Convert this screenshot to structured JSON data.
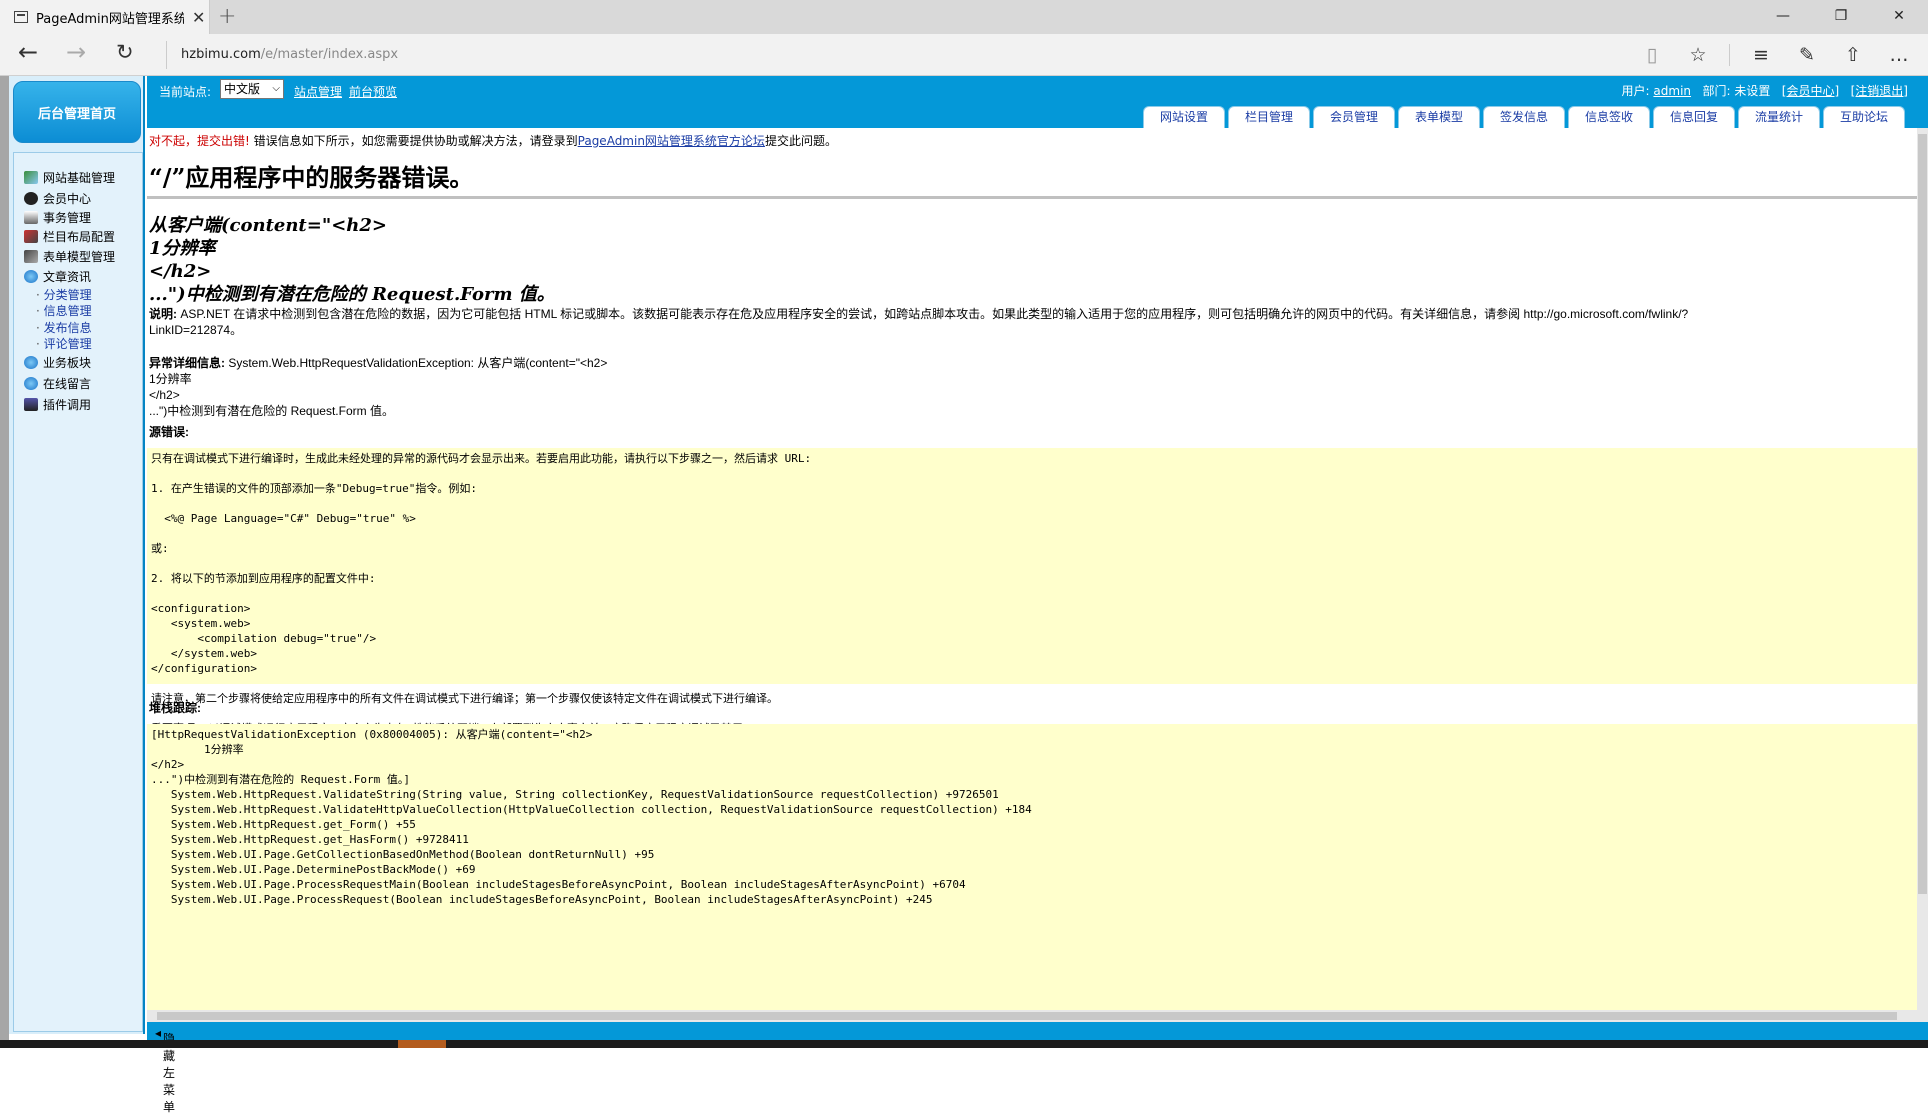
{
  "browser": {
    "tab_title": "PageAdmin网站管理系统",
    "url_host": "hzbimu.com",
    "url_path": "/e/master/index.aspx"
  },
  "topbar": {
    "site_label": "当前站点:",
    "site_value": "中文版",
    "link_site_manage": "站点管理",
    "link_preview": "前台预览",
    "user_label": "用户:",
    "user_name": "admin",
    "dept": "部门: 未设置",
    "member_center": "[会员中心]",
    "logout": "[注销退出]"
  },
  "nav_tabs": [
    "网站设置",
    "栏目管理",
    "会员管理",
    "表单模型",
    "签发信息",
    "信息签收",
    "信息回复",
    "流量统计",
    "互助论坛"
  ],
  "sidebar": {
    "home_label": "后台管理首页",
    "items": [
      "网站基础管理",
      "会员中心",
      "事务管理",
      "栏目布局配置",
      "表单模型管理",
      "文章资讯"
    ],
    "subitems": [
      "分类管理",
      "信息管理",
      "发布信息",
      "评论管理"
    ],
    "items2": [
      "业务板块",
      "在线留言",
      "插件调用"
    ],
    "hide_menu": "隐藏左菜单"
  },
  "content": {
    "err_prefix": "对不起，提交出错!",
    "err_text": " 错误信息如下所示，如您需要提供协助或解决方法，请登录到",
    "err_link": "PageAdmin网站管理系统官方论坛",
    "err_suffix": "提交此问题。",
    "title": "“/”应用程序中的服务器错误。",
    "h2_lines": [
      "从客户端(content=\"<h2>",
      "1分辨率",
      "</h2>",
      "...\")中检测到有潜在危险的 Request.Form 值。"
    ],
    "desc_label": "说明:",
    "desc_text": " ASP.NET 在请求中检测到包含潜在危险的数据，因为它可能包括 HTML 标记或脚本。该数据可能表示存在危及应用程序安全的尝试，如跨站点脚本攻击。如果此类型的输入适用于您的应用程序，则可包括明确允许的网页中的代码。有关详细信息，请参阅 http://go.microsoft.com/fwlink/?",
    "desc_text2": "LinkID=212874。",
    "exc_label": "异常详细信息:",
    "exc_text": " System.Web.HttpRequestValidationException: 从客户端(content=\"<h2>",
    "exc_lines": [
      "1分辨率",
      "</h2>",
      "...\")中检测到有潜在危险的 Request.Form 值。"
    ],
    "src_label": "源错误:",
    "src_box": "只有在调试模式下进行编译时，生成此未经处理的异常的源代码才会显示出来。若要启用此功能，请执行以下步骤之一，然后请求 URL:\n\n1. 在产生错误的文件的顶部添加一条\"Debug=true\"指令。例如:\n\n  <%@ Page Language=\"C#\" Debug=\"true\" %>\n\n或:\n\n2. 将以下的节添加到应用程序的配置文件中:\n\n<configuration>\n   <system.web>\n       <compilation debug=\"true\"/>\n   </system.web>\n</configuration>\n\n请注意，第二个步骤将使给定应用程序中的所有文件在调试模式下进行编译；第一个步骤仅使该特定文件在调试模式下进行编译。\n\n重要事项: 以调试模式运行应用程序一定会产生内存/性能系统开销。在部署到生产方案之前，应确保应用程序调试已禁用。",
    "stack_label": "堆栈跟踪:",
    "stack_box": "[HttpRequestValidationException (0x80004005): 从客户端(content=\"<h2>\n        1分辨率\n</h2>\n...\")中检测到有潜在危险的 Request.Form 值。]\n   System.Web.HttpRequest.ValidateString(String value, String collectionKey, RequestValidationSource requestCollection) +9726501\n   System.Web.HttpRequest.ValidateHttpValueCollection(HttpValueCollection collection, RequestValidationSource requestCollection) +184\n   System.Web.HttpRequest.get_Form() +55\n   System.Web.HttpRequest.get_HasForm() +9728411\n   System.Web.UI.Page.GetCollectionBasedOnMethod(Boolean dontReturnNull) +95\n   System.Web.UI.Page.DeterminePostBackMode() +69\n   System.Web.UI.Page.ProcessRequestMain(Boolean includeStagesBeforeAsyncPoint, Boolean includeStagesAfterAsyncPoint) +6704\n   System.Web.UI.Page.ProcessRequest(Boolean includeStagesBeforeAsyncPoint, Boolean includeStagesAfterAsyncPoint) +245"
  }
}
